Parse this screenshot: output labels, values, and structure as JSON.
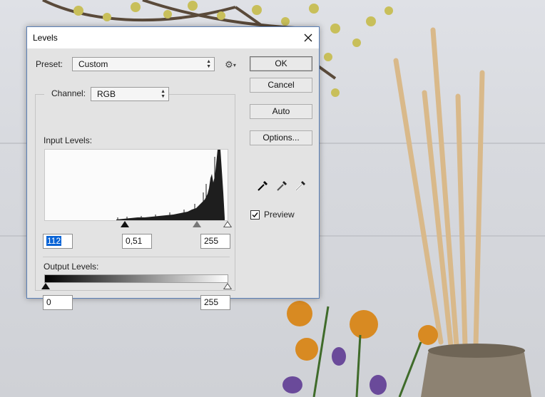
{
  "dialog": {
    "title": "Levels",
    "preset_label": "Preset:",
    "preset_value": "Custom",
    "channel_label": "Channel:",
    "channel_value": "RGB",
    "input_levels_label": "Input Levels:",
    "input_black": "112",
    "input_gamma": "0,51",
    "input_white": "255",
    "output_levels_label": "Output Levels:",
    "output_black": "0",
    "output_white": "255",
    "buttons": {
      "ok": "OK",
      "cancel": "Cancel",
      "auto": "Auto",
      "options": "Options..."
    },
    "preview_label": "Preview",
    "preview_checked": true
  },
  "icons": [
    "close-icon",
    "gear-icon",
    "black-eyedropper-icon",
    "gray-eyedropper-icon",
    "white-eyedropper-icon",
    "checkmark-icon"
  ]
}
